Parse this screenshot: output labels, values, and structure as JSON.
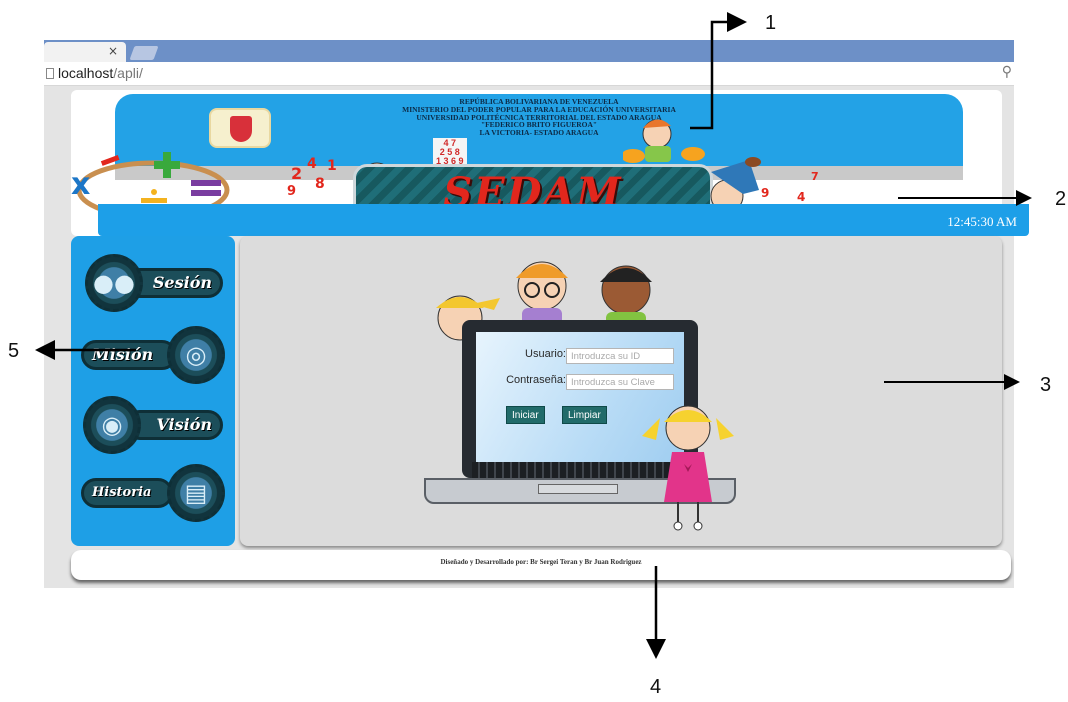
{
  "browser": {
    "tab_close": "×",
    "url_host": "localhost",
    "url_path": "/apli/",
    "zoom_icon": "magnifier-icon"
  },
  "header": {
    "lines": [
      "REPÚBLICA BOLIVARIANA DE VENEZUELA",
      "MINISTERIO DEL PODER POPULAR PARA LA EDUCACIÓN UNIVERSITARIA",
      "UNIVERSIDAD POLITÉCNICA TERRITORIAL DEL ESTADO ARAGUA",
      "\"FEDERICO BRITO FIGUEROA\"",
      "LA VICTORIA- ESTADO ARAGUA"
    ],
    "logo_text": "SEDAM",
    "clock": "12:45:30 AM",
    "colors": {
      "banner": "#23a2e6",
      "bar": "#1d9fe8"
    }
  },
  "sidebar": {
    "items": [
      {
        "label": "Sesión",
        "icon": "users-icon"
      },
      {
        "label": "Misión",
        "icon": "target-icon"
      },
      {
        "label": "Visión",
        "icon": "eye-icon"
      },
      {
        "label": "Historia",
        "icon": "book-icon"
      }
    ]
  },
  "login": {
    "user_label": "Usuario:",
    "user_placeholder": "Introduzca su ID",
    "pass_label": "Contraseña:",
    "pass_placeholder": "Introduzca su Clave",
    "submit_label": "Iniciar",
    "clear_label": "Limpiar"
  },
  "footer": {
    "text": "Diseñado y Desarrollado por: Br Sergei Teran y Br Juan Rodriguez"
  },
  "annotations": {
    "n1": "1",
    "n2": "2",
    "n3": "3",
    "n4": "4",
    "n5": "5"
  }
}
